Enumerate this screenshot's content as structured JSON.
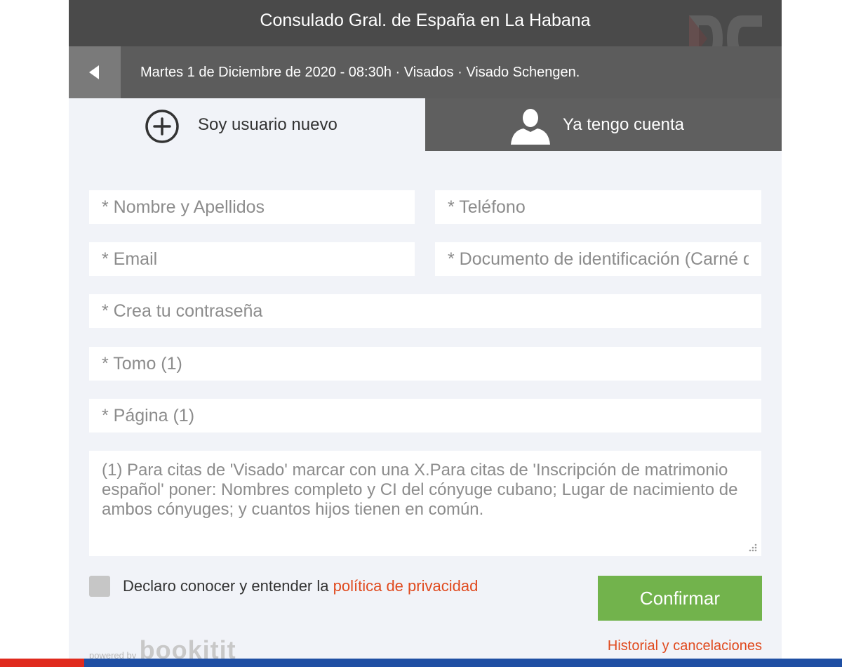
{
  "header": {
    "title": "Consulado Gral. de España en La Habana",
    "appointment_info": "Martes 1 de Diciembre de 2020 - 08:30h · Visados · Visado Schengen."
  },
  "tabs": {
    "new_user": "Soy usuario nuevo",
    "existing_account": "Ya tengo cuenta"
  },
  "form": {
    "name_placeholder": "* Nombre y Apellidos",
    "phone_placeholder": "* Teléfono",
    "email_placeholder": "* Email",
    "id_doc_placeholder": "* Documento de identificación (Carné de identidad o Pasaporte)",
    "password_placeholder": "* Crea tu contraseña",
    "tomo_placeholder": "* Tomo (1)",
    "pagina_placeholder": "* Página (1)",
    "notes_text": "(1) Para citas de 'Visado' marcar con una X.Para citas de 'Inscripción de matrimonio español' poner: Nombres completo y CI del cónyuge cubano; Lugar de nacimiento de ambos cónyuges; y cuantos hijos tienen en común."
  },
  "consent": {
    "text": "Declaro conocer y entender la ",
    "link": "política de privacidad"
  },
  "actions": {
    "confirm": "Confirmar",
    "history": "Historial y cancelaciones"
  },
  "footer": {
    "powered_prefix": "powered by",
    "brand": "bookitit"
  },
  "watermark": {
    "text": "DC"
  },
  "icons": {
    "back": "back-arrow-icon",
    "new_user": "plus-circle-icon",
    "existing": "user-silhouette-icon"
  },
  "colors": {
    "title_bar": "#4a4a4a",
    "info_bar": "#5c5c5c",
    "confirm": "#72b34c",
    "link": "#e04a1e",
    "footer_red": "#e02a1e",
    "footer_blue": "#1f4fa3"
  }
}
